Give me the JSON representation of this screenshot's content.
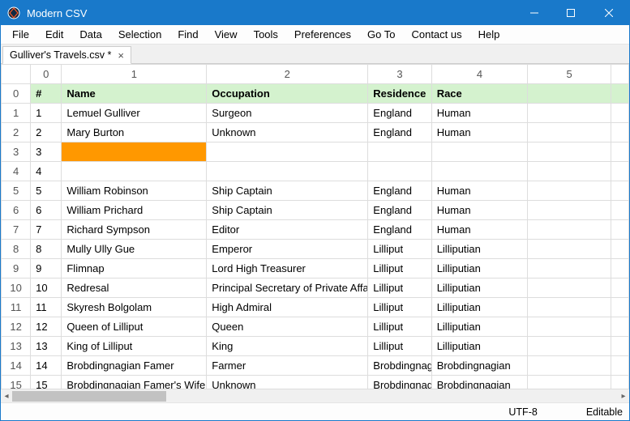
{
  "app_title": "Modern CSV",
  "menubar": [
    "File",
    "Edit",
    "Data",
    "Selection",
    "Find",
    "View",
    "Tools",
    "Preferences",
    "Go To",
    "Contact us",
    "Help"
  ],
  "tab": {
    "label": "Gulliver's Travels.csv *"
  },
  "col_headers": [
    "0",
    "1",
    "2",
    "3",
    "4",
    "5"
  ],
  "header_row": {
    "rownum": "0",
    "cells": [
      "#",
      "Name",
      "Occupation",
      "Residence",
      "Race",
      ""
    ]
  },
  "rows": [
    {
      "rownum": "1",
      "cells": [
        "1",
        "Lemuel Gulliver",
        "Surgeon",
        "England",
        "Human",
        ""
      ]
    },
    {
      "rownum": "2",
      "cells": [
        "2",
        "Mary Burton",
        "Unknown",
        "England",
        "Human",
        ""
      ]
    },
    {
      "rownum": "3",
      "cells": [
        "3",
        "",
        "",
        "",
        "",
        ""
      ],
      "active_col": 1
    },
    {
      "rownum": "4",
      "cells": [
        "4",
        "",
        "",
        "",
        "",
        ""
      ]
    },
    {
      "rownum": "5",
      "cells": [
        "5",
        "William Robinson",
        "Ship Captain",
        "England",
        "Human",
        ""
      ]
    },
    {
      "rownum": "6",
      "cells": [
        "6",
        "William Prichard",
        "Ship Captain",
        "England",
        "Human",
        ""
      ]
    },
    {
      "rownum": "7",
      "cells": [
        "7",
        "Richard Sympson",
        "Editor",
        "England",
        "Human",
        ""
      ]
    },
    {
      "rownum": "8",
      "cells": [
        "8",
        "Mully Ully Gue",
        "Emperor",
        "Lilliput",
        "Lilliputian",
        ""
      ]
    },
    {
      "rownum": "9",
      "cells": [
        "9",
        "Flimnap",
        "Lord High Treasurer",
        "Lilliput",
        "Lilliputian",
        ""
      ]
    },
    {
      "rownum": "10",
      "cells": [
        "10",
        "Redresal",
        "Principal Secretary of Private Affairs",
        "Lilliput",
        "Lilliputian",
        ""
      ]
    },
    {
      "rownum": "11",
      "cells": [
        "11",
        "Skyresh Bolgolam",
        "High Admiral",
        "Lilliput",
        "Lilliputian",
        ""
      ]
    },
    {
      "rownum": "12",
      "cells": [
        "12",
        "Queen of Lilliput",
        "Queen",
        "Lilliput",
        "Lilliputian",
        ""
      ]
    },
    {
      "rownum": "13",
      "cells": [
        "13",
        "King of Lilliput",
        "King",
        "Lilliput",
        "Lilliputian",
        ""
      ]
    },
    {
      "rownum": "14",
      "cells": [
        "14",
        "Brobdingnagian Famer",
        "Farmer",
        "Brobdingnag",
        "Brobdingnagian",
        ""
      ]
    }
  ],
  "partial_row": {
    "rownum": "15",
    "cells": [
      "15",
      "Brobdingnagian Famer's Wife",
      "Unknown",
      "Brobdingnag",
      "Brobdingnagian",
      ""
    ]
  },
  "status": {
    "encoding": "UTF-8",
    "mode": "Editable"
  }
}
